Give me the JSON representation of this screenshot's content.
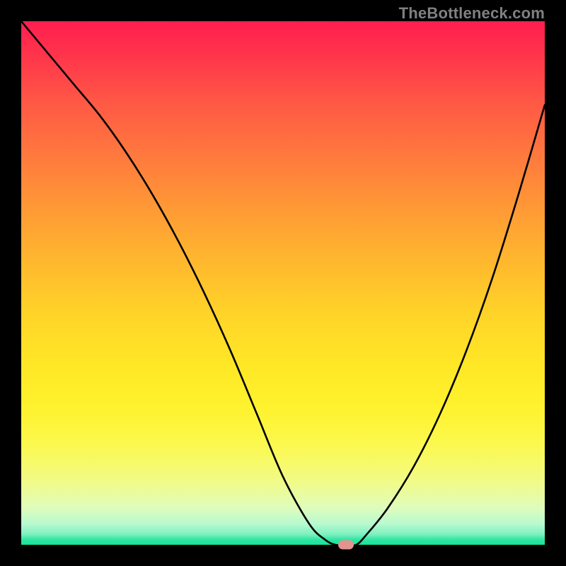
{
  "watermark": "TheBottleneck.com",
  "chart_data": {
    "type": "line",
    "title": "",
    "xlabel": "",
    "ylabel": "",
    "xlim": [
      0,
      100
    ],
    "ylim": [
      0,
      100
    ],
    "x": [
      0,
      5,
      10,
      15,
      20,
      25,
      30,
      35,
      40,
      45,
      50,
      55,
      58,
      60,
      62,
      64,
      66,
      70,
      75,
      80,
      85,
      90,
      95,
      100
    ],
    "values": [
      100,
      94,
      88,
      82,
      75,
      67,
      58,
      48,
      37,
      25,
      13,
      4,
      1,
      0,
      0,
      0,
      2,
      7,
      15,
      25,
      37,
      51,
      67,
      84
    ],
    "marker": {
      "x": 62,
      "y": 0
    },
    "gradient_stops": [
      {
        "pos": 0,
        "color": "#ff1e4e"
      },
      {
        "pos": 50,
        "color": "#ffd428"
      },
      {
        "pos": 80,
        "color": "#fcf84a"
      },
      {
        "pos": 100,
        "color": "#14e59a"
      }
    ]
  }
}
